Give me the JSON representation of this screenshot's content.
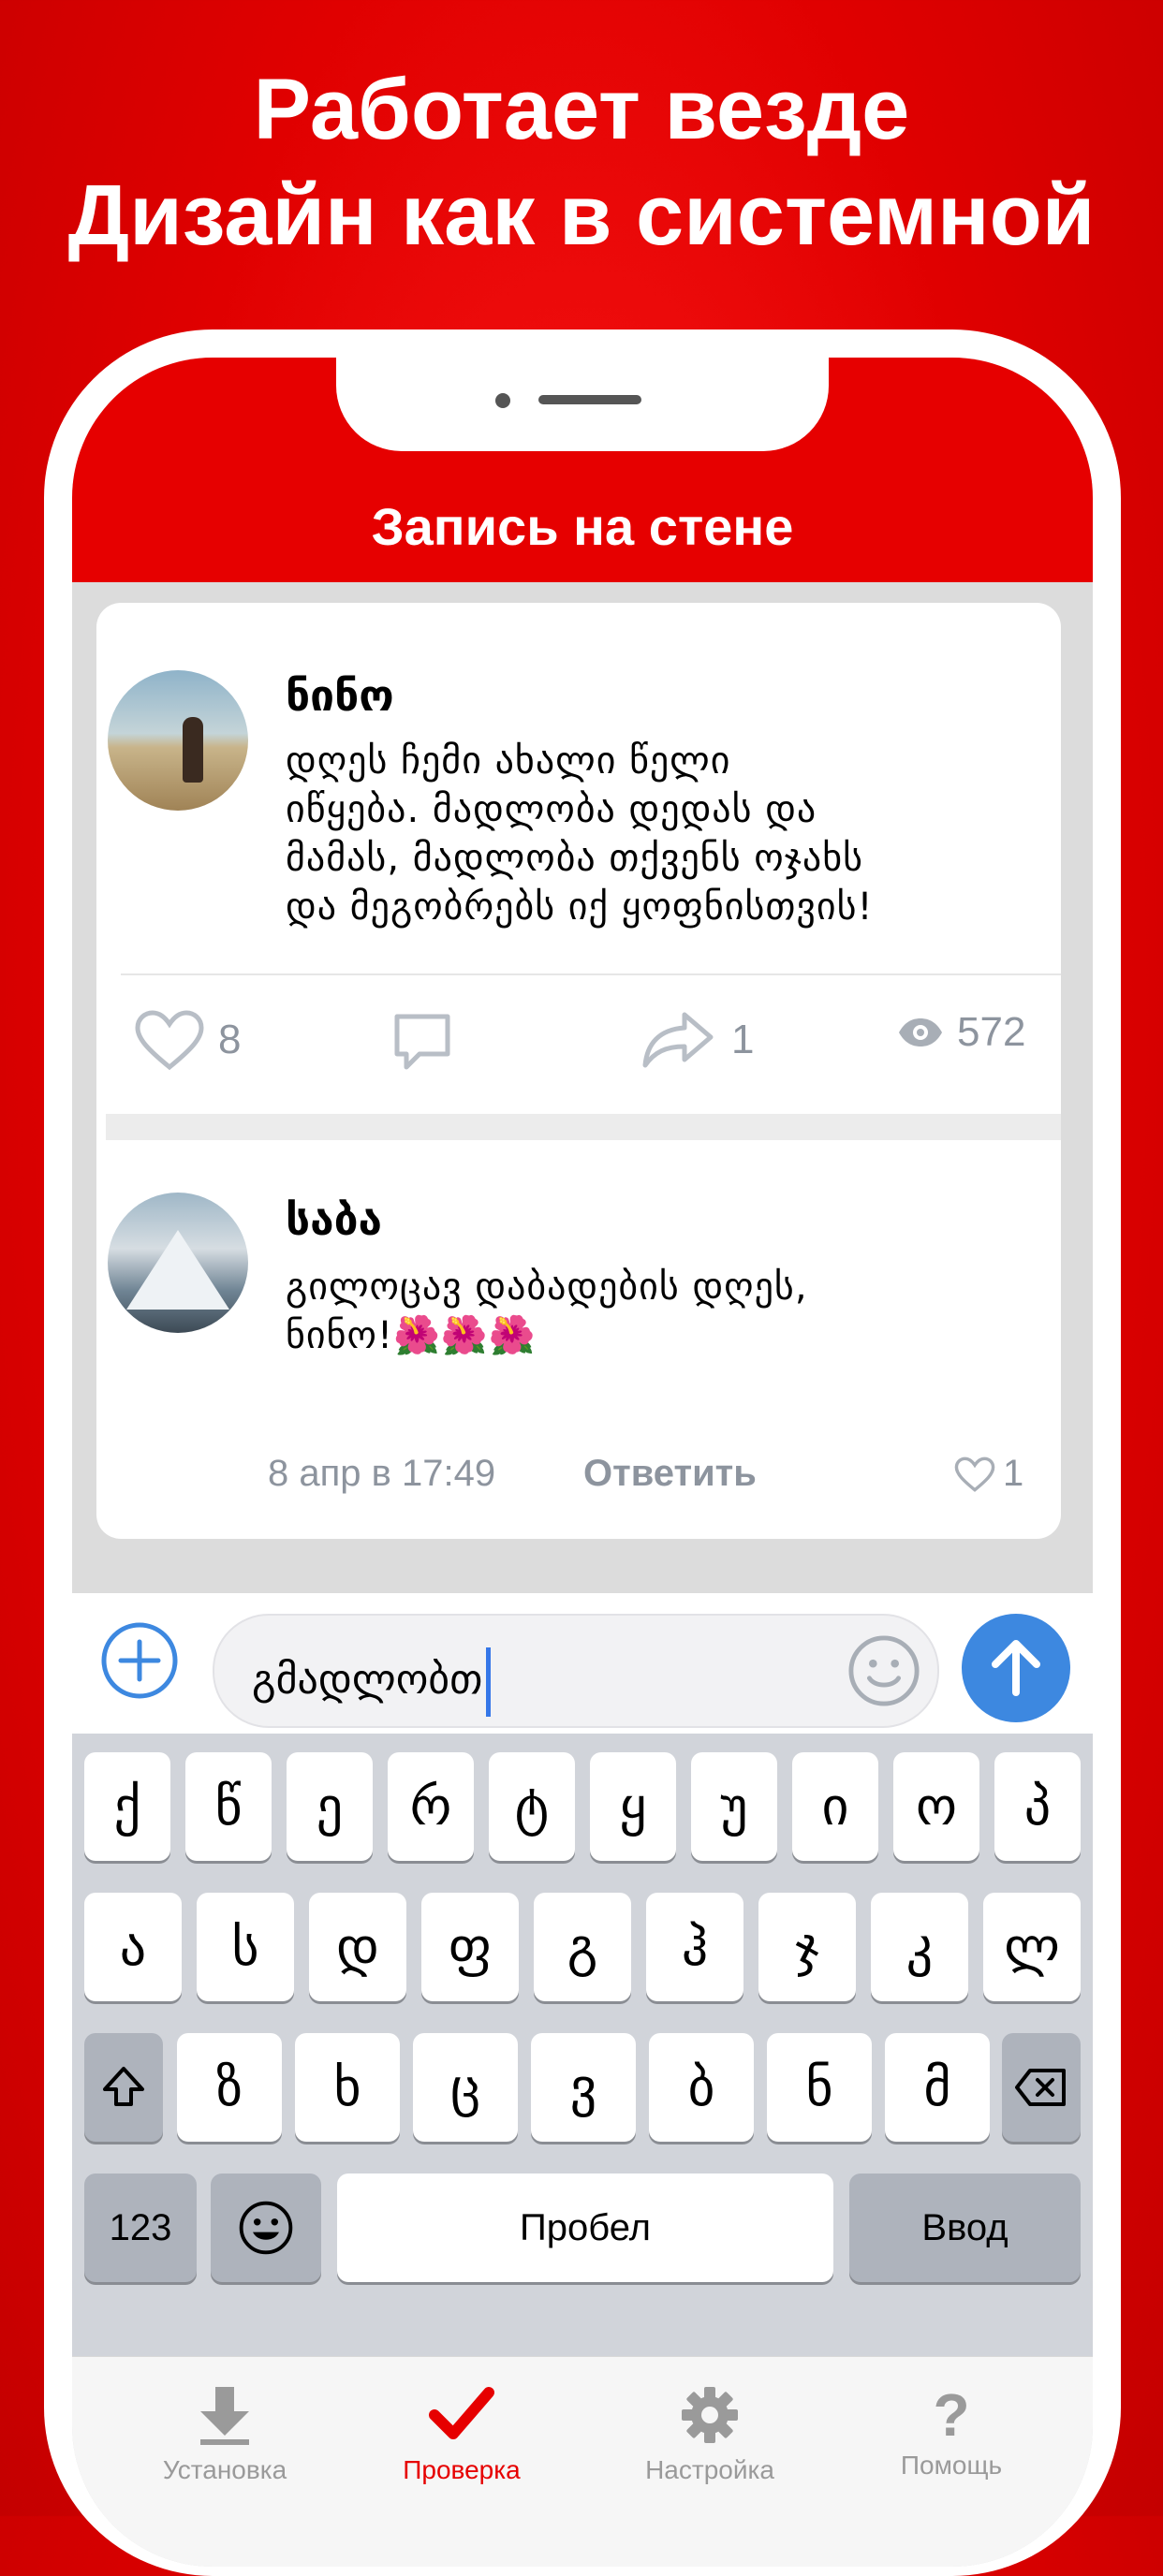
{
  "promo": {
    "line1": "Работает везде",
    "line2": "Дизайн как в системной"
  },
  "nav": {
    "title": "Запись на стене"
  },
  "post": {
    "author": "ნინო",
    "lines": [
      "დღეს ჩემი ახალი წელი",
      "იწყება. მადლობა დედას და",
      "მამას, მადლობა თქვენს ოჯახს",
      "და მეგობრებს იქ ყოფნისთვის!"
    ],
    "likes": "8",
    "shares": "1",
    "views": "572"
  },
  "comment": {
    "author": "საბა",
    "lines": [
      "გილოცავ დაბადების დღეს,",
      "ნინო!🌺🌺🌺"
    ],
    "time": "8 апр в 17:49",
    "reply_label": "Ответить",
    "likes": "1"
  },
  "composer": {
    "value": "გმადლობთ"
  },
  "keyboard": {
    "row1": [
      "ქ",
      "წ",
      "ე",
      "რ",
      "ტ",
      "ყ",
      "უ",
      "ი",
      "ო",
      "პ"
    ],
    "row2": [
      "ა",
      "ს",
      "დ",
      "ფ",
      "გ",
      "ჰ",
      "ჯ",
      "კ",
      "ლ"
    ],
    "row3": [
      "ზ",
      "ხ",
      "ც",
      "ვ",
      "ბ",
      "ნ",
      "მ"
    ],
    "numbers_label": "123",
    "space_label": "Пробел",
    "return_label": "Ввод"
  },
  "tabs": {
    "install": "Установка",
    "check": "Проверка",
    "settings": "Настройка",
    "help": "Помощь"
  },
  "colors": {
    "brand_red": "#e60000",
    "send_blue": "#3d88e0",
    "meta_gray": "#8d949e"
  }
}
